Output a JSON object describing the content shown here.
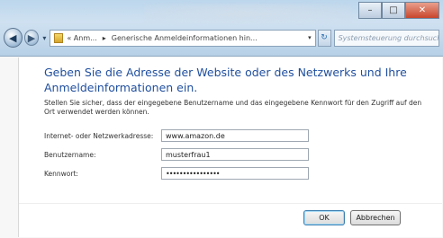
{
  "window": {
    "caption_buttons": [
      "–",
      "□",
      "✕"
    ]
  },
  "nav": {
    "back_glyph": "◀",
    "forward_glyph": "▶",
    "dropdown_glyph": "▾",
    "address": {
      "crumb_prefix": "« Anm...",
      "separator": "▸",
      "crumb_current": "Generische Anmeldeinformationen hin...",
      "dropdown_glyph": "▾"
    },
    "refresh_glyph": "↻",
    "search_placeholder": "Systemsteuerung durchsuchen",
    "search_glyph": "⚲"
  },
  "dialog": {
    "heading": "Geben Sie die Adresse der Website oder des Netzwerks und Ihre Anmeldeinformationen ein.",
    "description": "Stellen Sie sicher, dass der eingegebene Benutzername und das eingegebene Kennwort für den Zugriff auf den Ort verwendet werden können.",
    "fields": {
      "address_label": "Internet- oder Netzwerkadresse:",
      "address_value": "www.amazon.de",
      "username_label": "Benutzername:",
      "username_value": "musterfrau1",
      "password_label": "Kennwort:",
      "password_value": "••••••••••••••••"
    },
    "buttons": {
      "ok": "OK",
      "cancel": "Abbrechen"
    }
  }
}
